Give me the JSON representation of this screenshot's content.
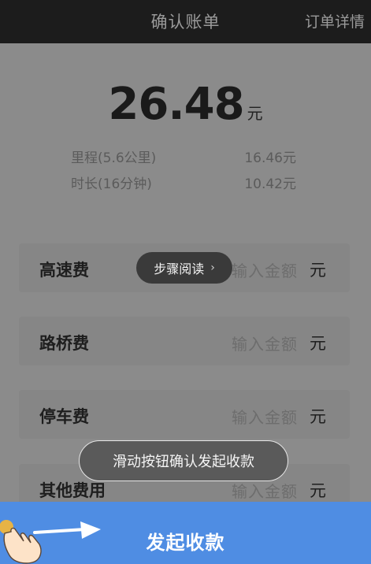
{
  "header": {
    "title": "确认账单",
    "detail_link": "订单详情"
  },
  "bill": {
    "total": "26.48",
    "total_unit": "元",
    "mileage_label": "里程(5.6公里)",
    "mileage_value": "16.46元",
    "duration_label": "时长(16分钟)",
    "duration_value": "10.42元"
  },
  "extra_fees": [
    {
      "label": "高速费",
      "placeholder": "输入金额",
      "unit": "元"
    },
    {
      "label": "路桥费",
      "placeholder": "输入金额",
      "unit": "元"
    },
    {
      "label": "停车费",
      "placeholder": "输入金额",
      "unit": "元"
    },
    {
      "label": "其他费用",
      "placeholder": "输入金额",
      "unit": "元"
    }
  ],
  "overlay": {
    "step_reading": "步骤阅读",
    "hint": "滑动按钮确认发起收款"
  },
  "footer": {
    "button_label": "发起收款"
  },
  "colors": {
    "topbar": "#1c1c1c",
    "button": "#4f8de3"
  },
  "icons": {
    "hand": "pointing-hand-icon",
    "arrow": "swipe-arrow-icon",
    "chevron": "chevron-right-icon"
  }
}
